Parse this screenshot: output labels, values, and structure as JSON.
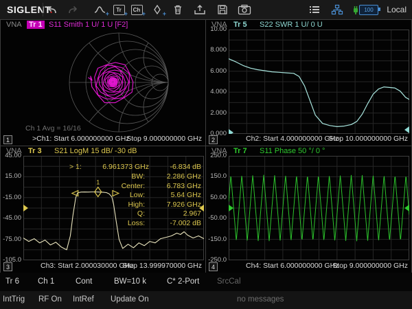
{
  "toolbar": {
    "logo": "SIGLENT",
    "local_label": "Local",
    "battery_level": "100",
    "tr_icon_label": "Tr",
    "ch_icon_label": "Ch",
    "icons": [
      "undo",
      "redo",
      "add-trace",
      "add-trace-window",
      "add-channel",
      "add-marker",
      "trash",
      "recall",
      "save",
      "screenshot",
      "menu",
      "lan",
      "usb",
      "battery"
    ]
  },
  "quadrants": {
    "q1": {
      "vna": "VNA",
      "trace_label": "Tr 1",
      "format": "S11 Smith 1 U/ 1 U [F2]",
      "avg_text": "Ch 1 Avg = 16/16",
      "number": "1",
      "start": ">Ch1: Start 6.000000000 GHz",
      "stop": "Stop 9.000000000 GHz"
    },
    "q2": {
      "vna": "VNA",
      "trace_label": "Tr 5",
      "format": "S22 SWR 1 U/ 0 U",
      "number": "2",
      "start": "Ch2: Start 4.000000000 GHz",
      "stop": "Stop 10.000000000 GHz",
      "y_labels": [
        "10.00",
        "8.000",
        "6.000",
        "4.000",
        "2.000",
        "0.000"
      ]
    },
    "q3": {
      "vna": "VNA",
      "trace_label": "Tr 3",
      "format": "S21 LogM 15 dB/ -30 dB",
      "number": "3",
      "start": "Ch3: Start 2.000030000 GHz",
      "stop": "Stop 13.999970000 GHz",
      "y_labels": [
        "45.00",
        "15.00",
        "-15.00",
        "-45.00",
        "-75.00",
        "-105.0"
      ],
      "marker_row": {
        "label": "> 1:",
        "freq": "6.961373 GHz",
        "value": "-6.834 dB"
      },
      "bw_rows": [
        {
          "label": "BW:",
          "value": "2.286 GHz"
        },
        {
          "label": "Center:",
          "value": "6.783 GHz"
        },
        {
          "label": "Low:",
          "value": "5.64 GHz"
        },
        {
          "label": "High:",
          "value": "7.926 GHz"
        },
        {
          "label": "Q:",
          "value": "2.967"
        },
        {
          "label": "Loss:",
          "value": "-7.002 dB"
        }
      ]
    },
    "q4": {
      "vna": "VNA",
      "trace_label": "Tr 7",
      "format": "S11 Phase 50 °/ 0 °",
      "number": "4",
      "start": "Ch4: Start 6.000000000 GHz",
      "stop": "Stop 9.000000000 GHz",
      "y_labels": [
        "250.0",
        "150.0",
        "50.00",
        "-50.00",
        "-150.0",
        "-250.0"
      ]
    }
  },
  "status_bar": {
    "items": [
      "Tr 6",
      "Ch 1",
      "Cont",
      "BW=10 k",
      "C* 2-Port",
      "SrcCal"
    ]
  },
  "bottom_bar": {
    "items": [
      "IntTrig",
      "RF On",
      "IntRef",
      "Update On"
    ],
    "message": "no messages"
  },
  "colors": {
    "magenta": "#df2cd6",
    "magenta_trace": "#e516d2",
    "cyan": "#8fd8d2",
    "cyan_trace": "#a9e6df",
    "yellow": "#ddc84f",
    "yellow_trace": "#e9e4bd",
    "green": "#2fca2f",
    "green_trace": "#2cc42c",
    "grid": "#262626",
    "frame": "#3d3d3d",
    "smith_grid": "#5a5a5a",
    "accent_blue": "#4a8fd4"
  },
  "chart_data": [
    {
      "id": "smith",
      "type": "line",
      "subtype": "smith_spiral",
      "title": "S11 Smith 1 U/ 1 U [F2]",
      "start_ghz": 6.0,
      "stop_ghz": 9.0,
      "center_offset": [
        -0.12,
        0.01
      ],
      "turns": 11,
      "r_outer": 0.44,
      "r_inner": 0.03,
      "tail": [
        [
          -0.62,
          0.1
        ],
        [
          -0.54,
          0.04
        ]
      ]
    },
    {
      "id": "swr",
      "type": "line",
      "title": "S22 SWR 1 U/ 0 U",
      "start_ghz": 4.0,
      "stop_ghz": 10.0,
      "ylim": [
        0,
        10
      ],
      "ref_value": 0,
      "x_frac": [
        0,
        0.04,
        0.08,
        0.12,
        0.16,
        0.2,
        0.24,
        0.28,
        0.32,
        0.36,
        0.39,
        0.42,
        0.45,
        0.48,
        0.52,
        0.56,
        0.6,
        0.64,
        0.68,
        0.71,
        0.74,
        0.77,
        0.8,
        0.83,
        0.86,
        0.89,
        0.92,
        0.95,
        0.98,
        1.0
      ],
      "values": [
        7.2,
        6.9,
        6.55,
        6.3,
        6.15,
        6.05,
        5.95,
        5.9,
        5.85,
        5.8,
        5.5,
        4.6,
        3.2,
        1.8,
        1.0,
        0.8,
        0.7,
        0.75,
        0.9,
        1.2,
        1.9,
        2.9,
        3.8,
        4.3,
        4.5,
        4.45,
        4.4,
        4.1,
        3.5,
        3.3
      ]
    },
    {
      "id": "s21",
      "type": "line",
      "title": "S21 LogM 15 dB/ -30 dB",
      "start_ghz": 2.00003,
      "stop_ghz": 13.99997,
      "ylim": [
        -105,
        45
      ],
      "ref_value": -30,
      "x_frac": [
        0,
        0.03,
        0.06,
        0.09,
        0.12,
        0.15,
        0.18,
        0.21,
        0.24,
        0.26,
        0.275,
        0.29,
        0.3,
        0.32,
        0.34,
        0.36,
        0.38,
        0.4,
        0.42,
        0.44,
        0.46,
        0.475,
        0.49,
        0.5,
        0.515,
        0.53,
        0.55,
        0.58,
        0.61,
        0.64,
        0.67,
        0.7,
        0.73,
        0.76,
        0.79,
        0.82,
        0.85,
        0.87,
        0.89,
        0.91,
        0.94,
        0.97,
        1.0
      ],
      "values": [
        -73,
        -78,
        -74,
        -80,
        -76,
        -83,
        -79,
        -86,
        -90,
        -70,
        -40,
        -15,
        -8.2,
        -7.0,
        -6.9,
        -7.0,
        -6.8,
        -6.8,
        -7.0,
        -7.2,
        -7.8,
        -9.5,
        -14,
        -25,
        -50,
        -75,
        -88,
        -82,
        -87,
        -80,
        -84,
        -78,
        -80,
        -74,
        -72,
        -70,
        -66,
        -68,
        -64,
        -69,
        -73,
        -70,
        -74
      ],
      "marker": {
        "n": "1",
        "freq_ghz": 6.961373,
        "level_db": -6.834,
        "low_ghz": 5.64,
        "high_ghz": 7.926
      }
    },
    {
      "id": "phase",
      "type": "line",
      "subtype": "triangle_wave",
      "title": "S11 Phase 50 °/ 0 °",
      "start_ghz": 6.0,
      "stop_ghz": 9.0,
      "ylim": [
        -250,
        250
      ],
      "ref_value": 0,
      "cycles": 16.5,
      "amplitude": 158,
      "phase_offset": 0.3
    }
  ]
}
